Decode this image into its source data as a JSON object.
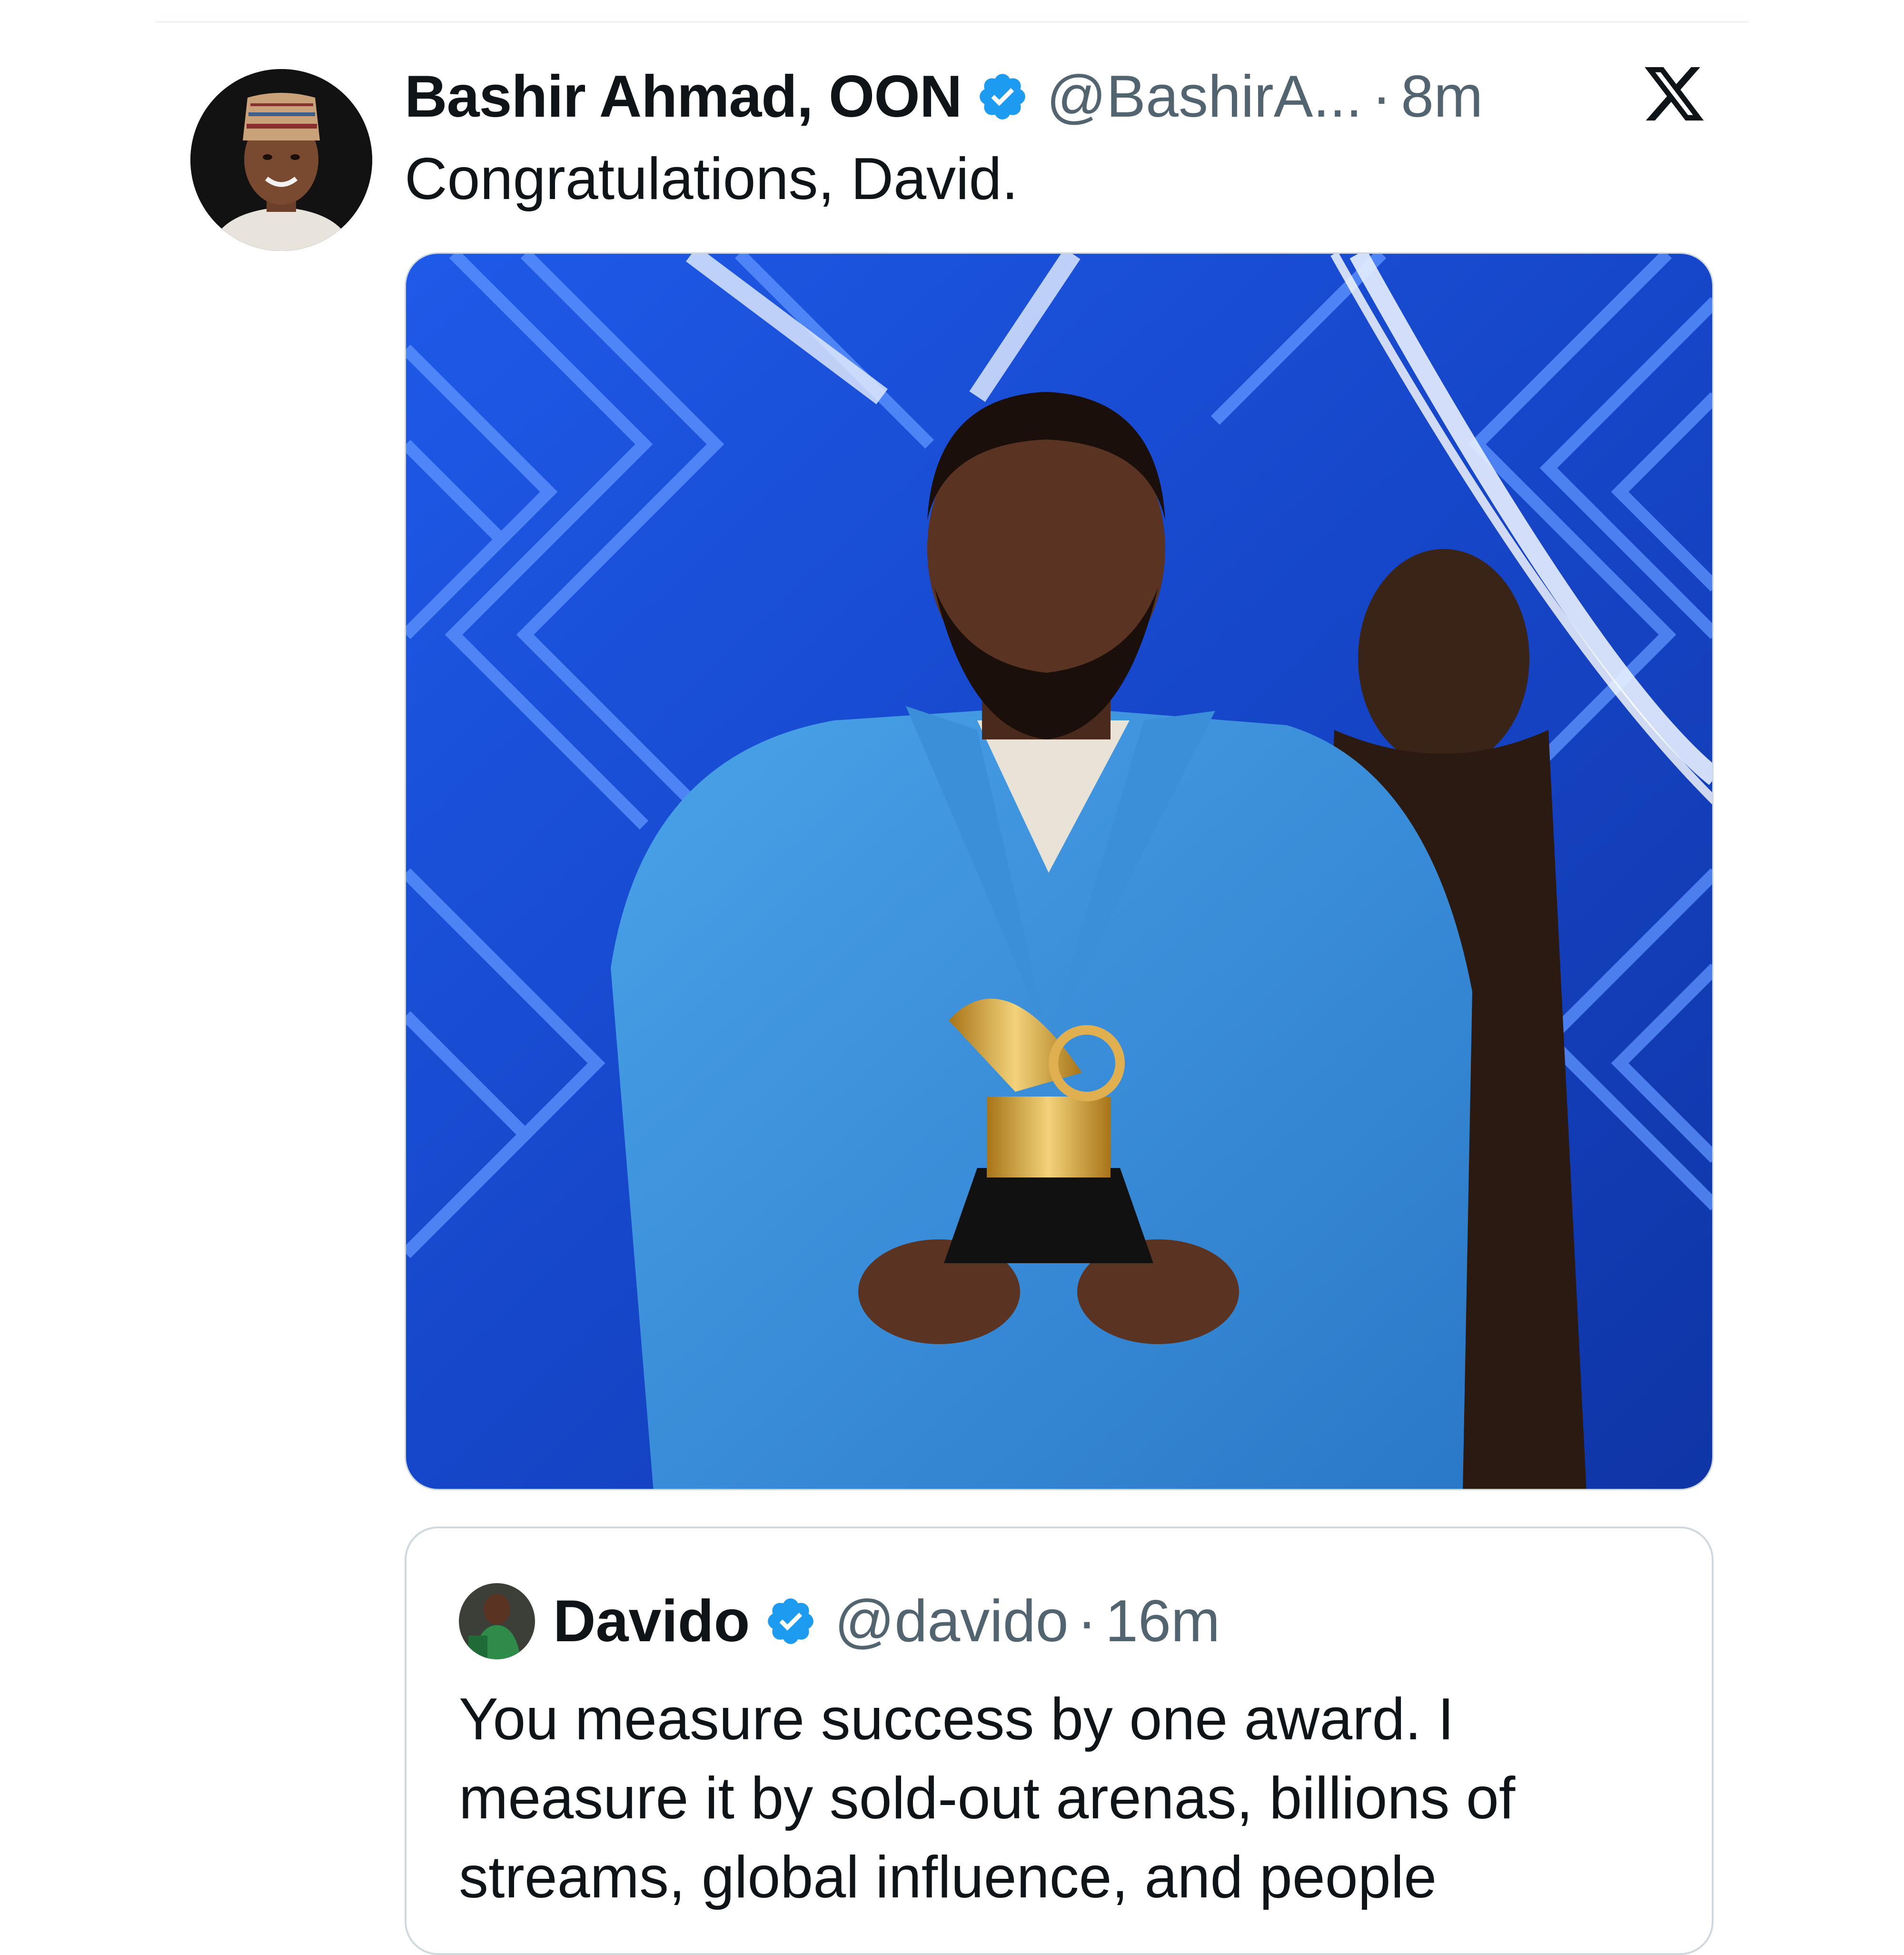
{
  "tweet": {
    "display_name": "Bashir Ahmad, OON",
    "handle": "@BashirA...",
    "separator": "·",
    "time": "8m",
    "text": "Congratulations, David.",
    "verified_icon": "verified-badge-icon",
    "platform_icon": "x-logo-icon",
    "media": {
      "subject": "man in blue suit holding gold gramophone trophy",
      "background_color": "#1a4fd6"
    }
  },
  "quote": {
    "display_name": "Davido",
    "handle": "@davido",
    "separator": "·",
    "time": "16m",
    "text": "You measure success by one award. I measure it by sold-out arenas, billions of streams, global influence, and people"
  },
  "colors": {
    "primary_text": "#0f1419",
    "secondary_text": "#536471",
    "verified_blue": "#1d9bf0",
    "border": "#cfd9de"
  }
}
